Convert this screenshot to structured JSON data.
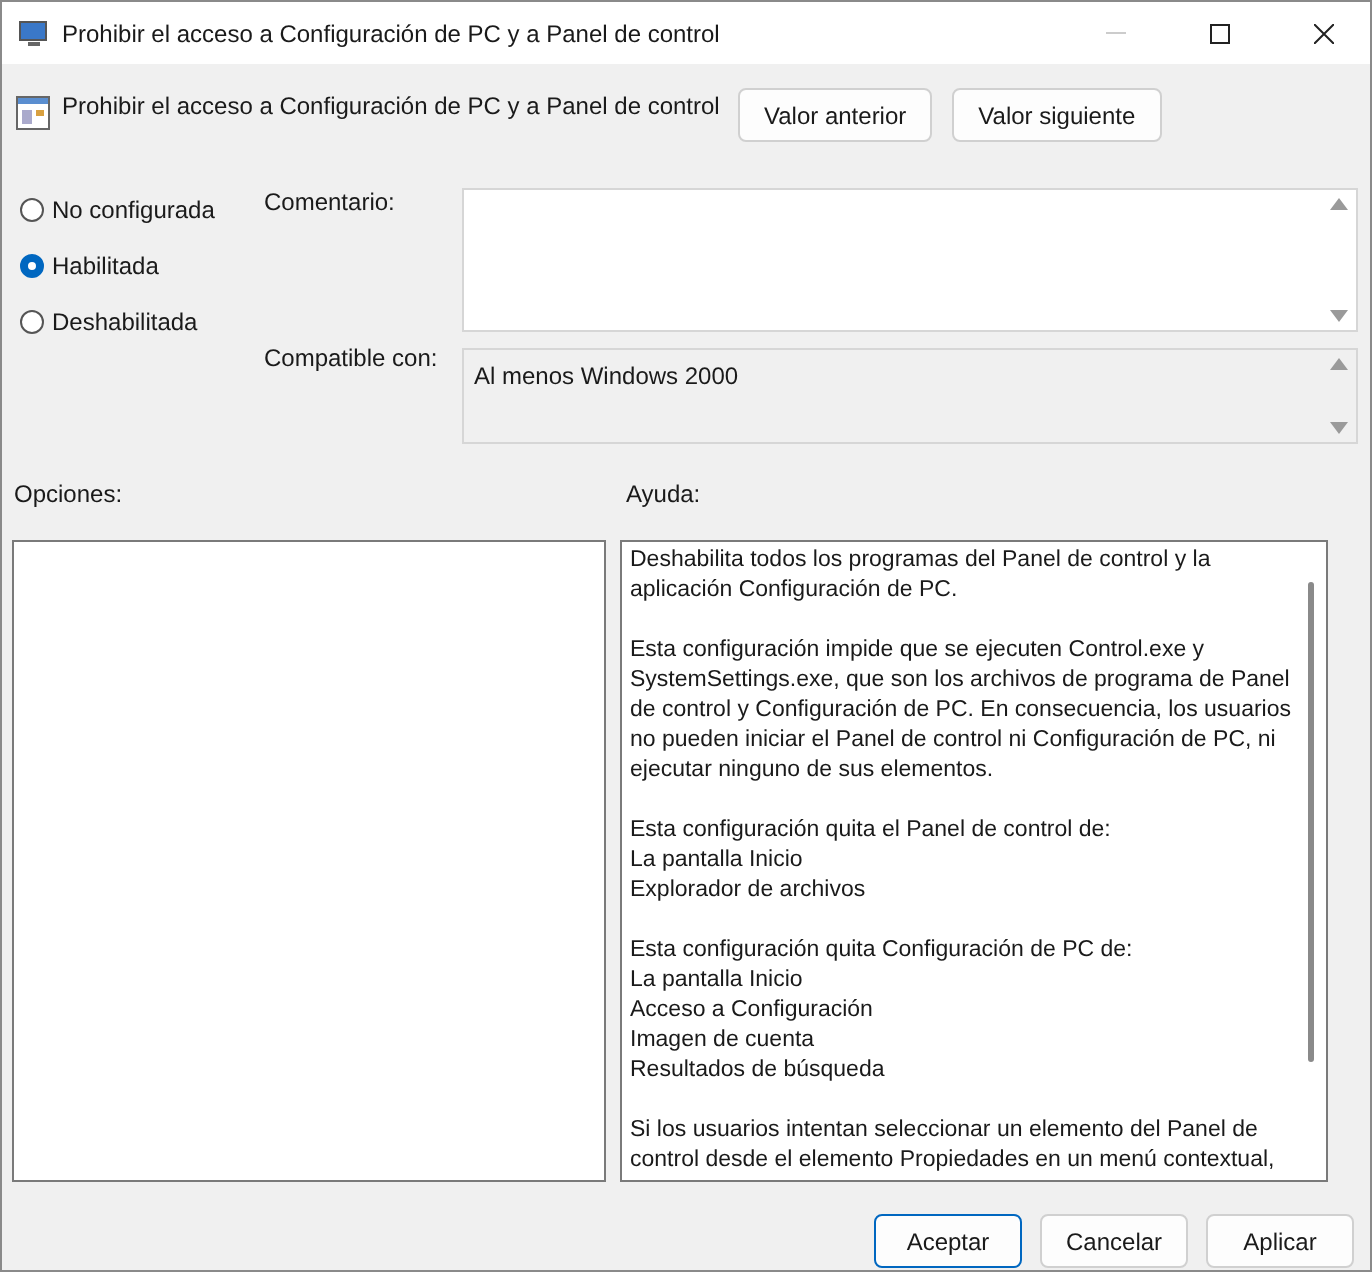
{
  "window": {
    "title": "Prohibir el acceso a Configuración de PC y a Panel de control"
  },
  "policy": {
    "title": "Prohibir el acceso a Configuración de PC y a Panel de control"
  },
  "nav_buttons": [
    "Valor anterior",
    "Valor siguiente"
  ],
  "states": [
    {
      "label": "No configurada",
      "selected": false
    },
    {
      "label": "Habilitada",
      "selected": true
    },
    {
      "label": "Deshabilitada",
      "selected": false
    }
  ],
  "comment": {
    "label": "Comentario:"
  },
  "compatible": {
    "label": "Compatible con:",
    "value": "Al menos Windows 2000"
  },
  "options": {
    "label": "Opciones:"
  },
  "help": {
    "label": "Ayuda:",
    "paragraphs": [
      [
        "Deshabilita todos los programas del Panel de control y la",
        "aplicación Configuración de PC."
      ],
      [
        "Esta configuración impide que se ejecuten Control.exe y",
        "SystemSettings.exe, que son los archivos de programa de Panel",
        "de control y Configuración de PC. En consecuencia, los usuarios",
        "no pueden iniciar el Panel de control ni Configuración de PC, ni",
        "ejecutar ninguno de sus elementos."
      ],
      [
        "Esta configuración quita el Panel de control de:",
        "La pantalla Inicio",
        "Explorador de archivos"
      ],
      [
        "Esta configuración quita Configuración de PC de:",
        "La pantalla Inicio",
        "Acceso a Configuración",
        "Imagen de cuenta",
        "Resultados de búsqueda"
      ],
      [
        "Si los usuarios intentan seleccionar un elemento del Panel de",
        "control desde el elemento Propiedades en un menú contextual,"
      ]
    ]
  },
  "buttons": [
    {
      "label": "Aceptar",
      "primary": true
    },
    {
      "label": "Cancelar",
      "primary": false
    },
    {
      "label": "Aplicar",
      "primary": false
    }
  ]
}
